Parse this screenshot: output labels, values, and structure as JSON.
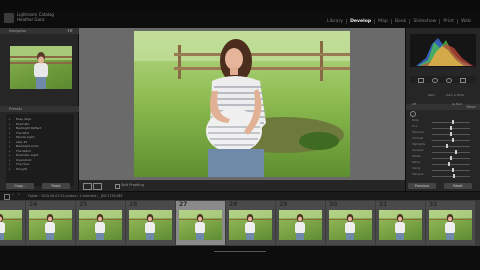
{
  "identity": {
    "catalog": "Lightroom Catalog",
    "user": "Heather Ganz"
  },
  "modules": [
    "Library",
    "Develop",
    "Map",
    "Book",
    "Slideshow",
    "Print",
    "Web"
  ],
  "active_module": "Develop",
  "left_panel": {
    "navigator_label": "Navigator",
    "navigator_zoom": "FIT",
    "presets_label": "Presets",
    "presets": [
      "Easy days",
      "Dramatic",
      "Backlight Reflect",
      "The Wild",
      "Woods Light",
      "Late 10",
      "Backlight Arms",
      "The Warm",
      "Dramatic Light",
      "Overshoot",
      "The Hour",
      "Tonight"
    ],
    "copy_label": "Copy...",
    "paste_label": "Paste"
  },
  "toolbar": {
    "soft_proofing": "Soft Proofing"
  },
  "right_panel": {
    "histogram_label": "Histogram",
    "basic_label": "Basic",
    "treatment": "Color",
    "treatment_alt": "Black & White",
    "wb_label": "WB",
    "wb_value": "As Shot",
    "sliders": [
      "Temp",
      "Tint",
      "Exposure",
      "Contrast",
      "Highlights",
      "Shadows",
      "Whites",
      "Blacks",
      "Clarity",
      "Vibrance"
    ],
    "slider_levels": [
      0.55,
      0.5,
      0.5,
      0.55,
      0.4,
      0.62,
      0.5,
      0.45,
      0.55,
      0.58
    ],
    "previous_label": "Previous",
    "reset_label": "Reset"
  },
  "filmstrip_bar": {
    "source": "Folder : 2015-06-03   43 photos / 1 selected / _DSC1756.NEF"
  },
  "filmstrip": {
    "numbers": [
      "",
      "24",
      "25",
      "26",
      "27",
      "28",
      "29",
      "30",
      "31",
      "32"
    ],
    "selected_index": 4
  },
  "colors": {
    "accent": "#f0f0f0",
    "panel": "#262626",
    "background": "#6a6a6a"
  }
}
